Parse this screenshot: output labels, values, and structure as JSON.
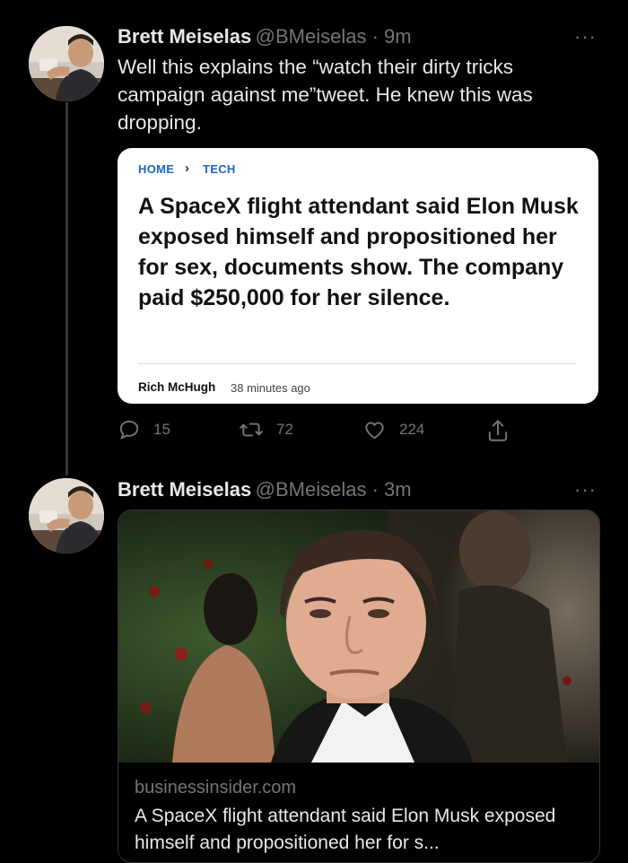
{
  "tweet1": {
    "author_name": "Brett Meiselas",
    "handle_time": "@BMeiselas · 9m",
    "text": "Well this explains the “watch their dirty tricks campaign against me”tweet. He knew this was dropping.",
    "more_glyph": "···",
    "card": {
      "breadcrumb_home": "HOME",
      "breadcrumb_sep": "›",
      "breadcrumb_section": "TECH",
      "headline": "A SpaceX flight attendant said Elon Musk exposed himself and propositioned her for sex, documents show. The company paid $250,000 for her silence.",
      "author": "Rich McHugh",
      "time_ago": "38 minutes ago"
    },
    "actions": {
      "replies": "15",
      "retweets": "72",
      "likes": "224"
    }
  },
  "tweet2": {
    "author_name": "Brett Meiselas",
    "handle_time": "@BMeiselas · 3m",
    "more_glyph": "···",
    "link_card": {
      "domain": "businessinsider.com",
      "title": "A SpaceX flight attendant said Elon Musk exposed himself and propositioned her for s..."
    }
  },
  "colors": {
    "background": "#000000",
    "text": "#e7e9ea",
    "muted": "#71767b",
    "link_blue": "#1e64c8"
  },
  "icons": [
    "reply-icon",
    "retweet-icon",
    "like-icon",
    "share-icon",
    "more-icon"
  ]
}
